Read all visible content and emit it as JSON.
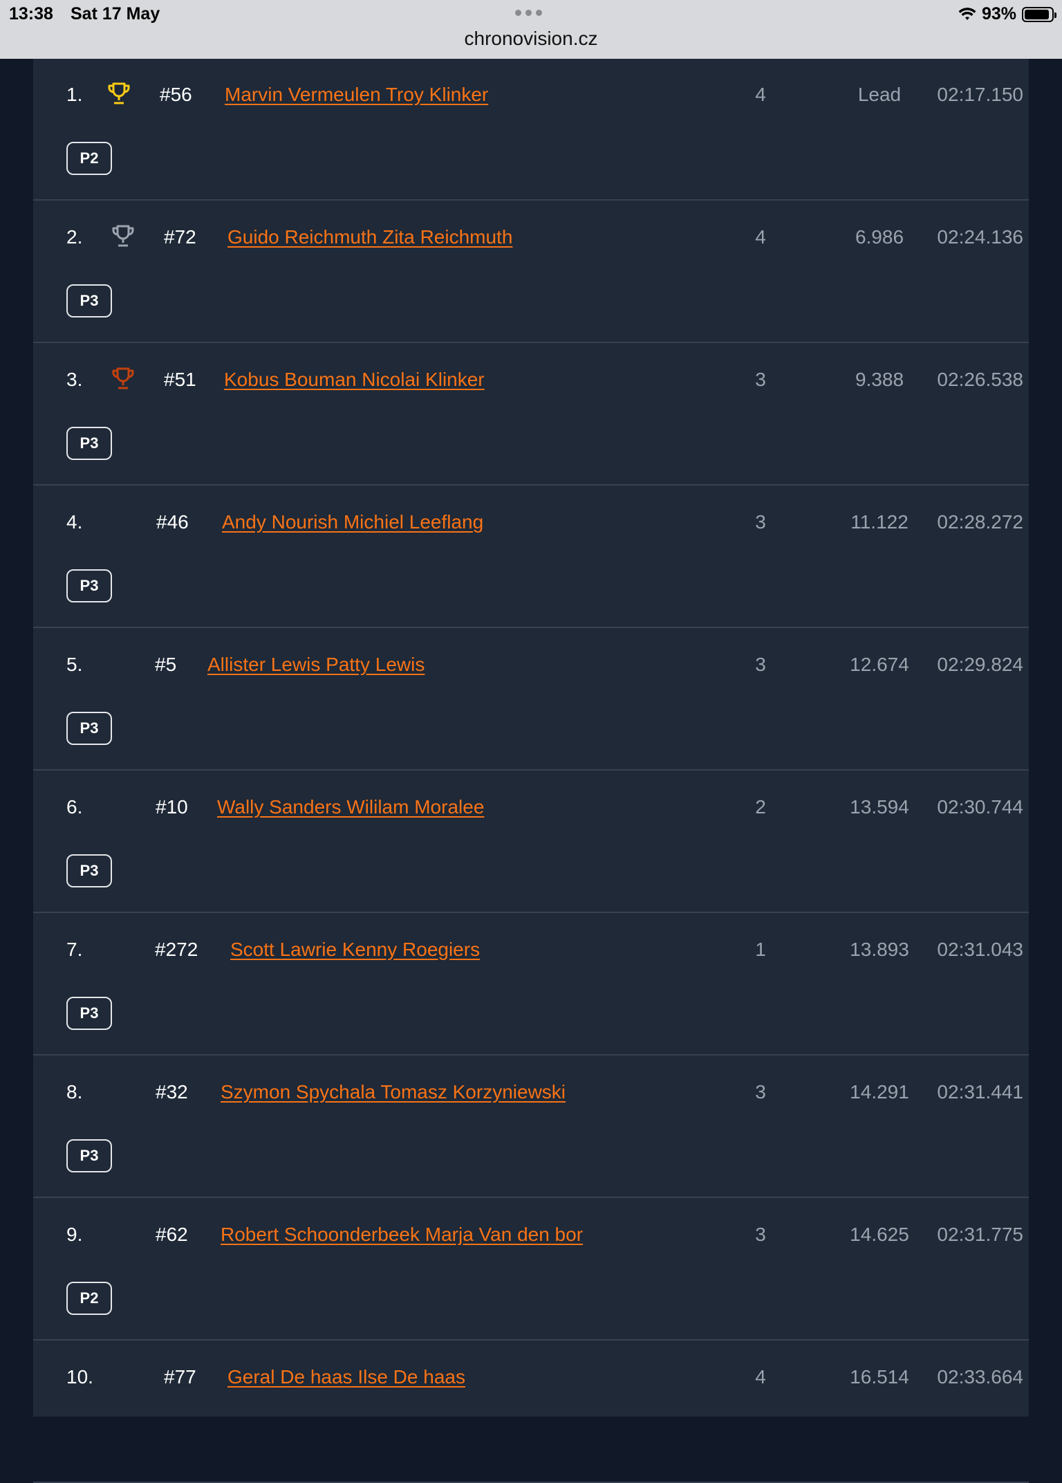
{
  "status_bar": {
    "time": "13:38",
    "date": "Sat 17 May",
    "url": "chronovision.cz",
    "battery": "93%",
    "battery_level": 0.93
  },
  "colors": {
    "link": "#f97316",
    "gold": "#facc15",
    "silver": "#9ca3af",
    "bronze": "#c2410c"
  },
  "results": [
    {
      "position": "1.",
      "trophy": "gold-trophy-icon",
      "number": "#56",
      "name": "Marvin Vermeulen Troy Klinker",
      "laps": "4",
      "gap": "Lead",
      "time": "02:17.150",
      "class": "P2"
    },
    {
      "position": "2.",
      "trophy": "silver-trophy-icon",
      "number": "#72",
      "name": "Guido Reichmuth Zita Reichmuth",
      "laps": "4",
      "gap": "6.986",
      "time": "02:24.136",
      "class": "P3"
    },
    {
      "position": "3.",
      "trophy": "bronze-trophy-icon",
      "number": "#51",
      "name": "Kobus Bouman Nicolai Klinker",
      "laps": "3",
      "gap": "9.388",
      "time": "02:26.538",
      "class": "P3"
    },
    {
      "position": "4.",
      "number": "#46",
      "name": "Andy Nourish Michiel Leeflang",
      "laps": "3",
      "gap": "11.122",
      "time": "02:28.272",
      "class": "P3"
    },
    {
      "position": "5.",
      "number": "#5",
      "name": "Allister Lewis Patty Lewis",
      "laps": "3",
      "gap": "12.674",
      "time": "02:29.824",
      "class": "P3"
    },
    {
      "position": "6.",
      "number": "#10",
      "name": "Wally Sanders Wililam Moralee",
      "laps": "2",
      "gap": "13.594",
      "time": "02:30.744",
      "class": "P3"
    },
    {
      "position": "7.",
      "number": "#272",
      "name": "Scott Lawrie Kenny Roegiers",
      "laps": "1",
      "gap": "13.893",
      "time": "02:31.043",
      "class": "P3"
    },
    {
      "position": "8.",
      "number": "#32",
      "name": "Szymon Spychala Tomasz Korzyniewski",
      "laps": "3",
      "gap": "14.291",
      "time": "02:31.441",
      "class": "P3"
    },
    {
      "position": "9.",
      "number": "#62",
      "name": "Robert Schoonderbeek Marja Van den bor",
      "laps": "3",
      "gap": "14.625",
      "time": "02:31.775",
      "class": "P2"
    },
    {
      "position": "10.",
      "number": "#77",
      "name": "Geral De haas Ilse De haas",
      "laps": "4",
      "gap": "16.514",
      "time": "02:33.664"
    }
  ]
}
